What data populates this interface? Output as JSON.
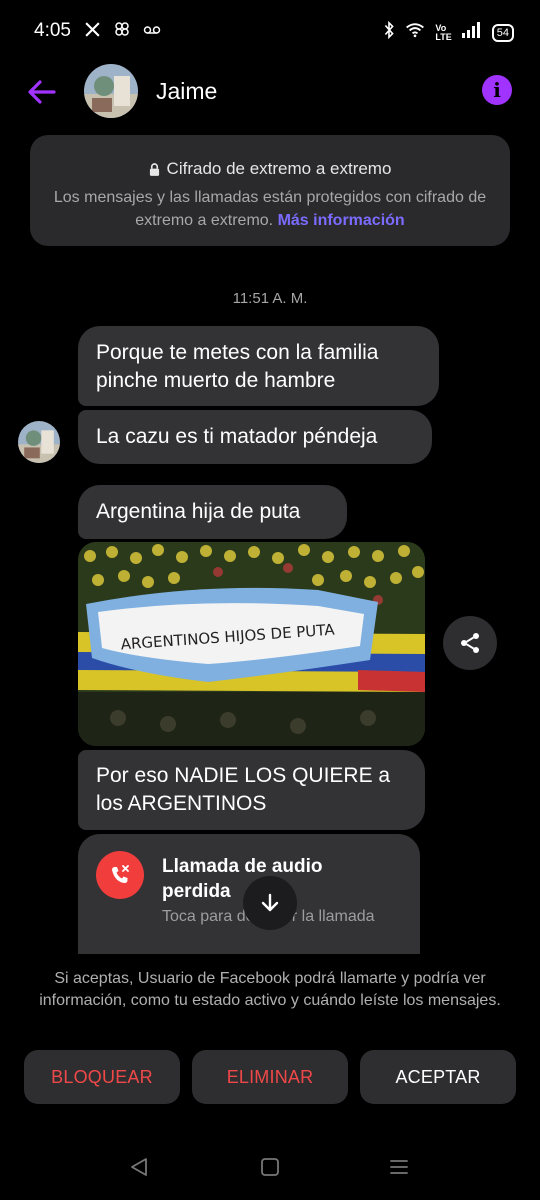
{
  "status_bar": {
    "time": "4:05",
    "battery": "54"
  },
  "header": {
    "contact_name": "Jaime"
  },
  "encryption_notice": {
    "title": "Cifrado de extremo a extremo",
    "body": "Los mensajes y las llamadas están protegidos con cifrado de extremo a extremo.",
    "link": "Más información"
  },
  "conversation": {
    "timestamp": "11:51 A. M.",
    "messages": [
      "Porque te metes con la familia pinche muerto de hambre",
      "La cazu es ti matador péndeja",
      "Argentina hija de puta",
      "Por eso NADIE LOS QUIERE a los ARGENTINOS"
    ],
    "photo_banner_text": "ARGENTINOS HIJOS DE PUTA",
    "missed_call": {
      "title": "Llamada de audio perdida",
      "subtitle": "Toca para devolver la llamada"
    }
  },
  "request": {
    "text": "Si aceptas, Usuario de Facebook podrá llamarte y podría ver información, como tu estado activo y cuándo leíste los mensajes.",
    "block_label": "BLOQUEAR",
    "delete_label": "ELIMINAR",
    "accept_label": "ACEPTAR"
  },
  "colors": {
    "accent": "#a033ff",
    "link": "#7b6cff",
    "danger": "#f04848",
    "bubble": "#333336",
    "background": "#000000"
  }
}
